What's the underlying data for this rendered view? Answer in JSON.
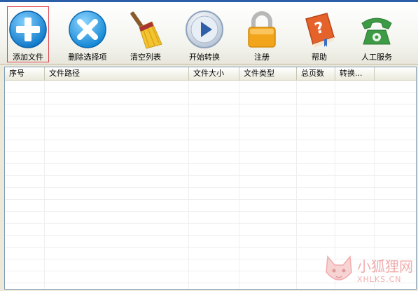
{
  "toolbar": {
    "buttons": [
      {
        "label": "添加文件",
        "icon": "plus-icon",
        "selected": true
      },
      {
        "label": "删除选择项",
        "icon": "x-icon"
      },
      {
        "label": "清空列表",
        "icon": "broom-icon"
      },
      {
        "label": "开始转换",
        "icon": "play-icon"
      },
      {
        "label": "注册",
        "icon": "lock-icon"
      },
      {
        "label": "帮助",
        "icon": "help-book-icon"
      },
      {
        "label": "人工服务",
        "icon": "phone-icon"
      }
    ]
  },
  "table": {
    "columns": [
      "序号",
      "文件路径",
      "文件大小",
      "文件类型",
      "总页数",
      "转换..."
    ],
    "rows": []
  },
  "watermark": {
    "text": "小狐狸网",
    "sub": "XHLKS.CN"
  },
  "colors": {
    "accent_blue": "#1e8fd9",
    "select_outline": "#e0404a",
    "lock_orange": "#f2a41a",
    "phone_green": "#3d9a45"
  }
}
